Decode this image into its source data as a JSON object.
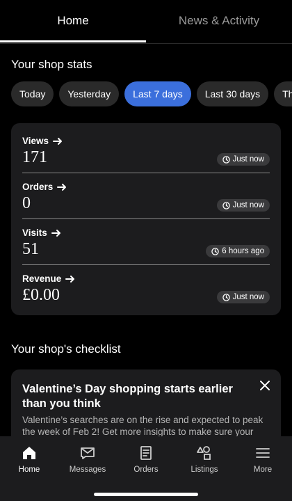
{
  "tabs": [
    {
      "label": "Home",
      "active": true
    },
    {
      "label": "News & Activity",
      "active": false
    }
  ],
  "shop_stats": {
    "title": "Your shop stats",
    "filters": [
      {
        "label": "Today",
        "active": false
      },
      {
        "label": "Yesterday",
        "active": false
      },
      {
        "label": "Last 7 days",
        "active": true
      },
      {
        "label": "Last 30 days",
        "active": false
      },
      {
        "label": "This",
        "active": false
      }
    ],
    "stats": [
      {
        "label": "Views",
        "value": "171",
        "updated": "Just now"
      },
      {
        "label": "Orders",
        "value": "0",
        "updated": "Just now"
      },
      {
        "label": "Visits",
        "value": "51",
        "updated": "6 hours ago"
      },
      {
        "label": "Revenue",
        "value": "£0.00",
        "updated": "Just now"
      }
    ]
  },
  "checklist": {
    "title": "Your shop's checklist",
    "card": {
      "title": "Valentine’s Day shopping starts earlier than you think",
      "body": "Valentine’s searches are on the rise and expected to peak the week of Feb 2! Get more insights to make sure your"
    }
  },
  "bottom_nav": [
    {
      "label": "Home",
      "icon": "home-icon",
      "active": true
    },
    {
      "label": "Messages",
      "icon": "messages-icon",
      "active": false
    },
    {
      "label": "Orders",
      "icon": "orders-icon",
      "active": false
    },
    {
      "label": "Listings",
      "icon": "listings-icon",
      "active": false
    },
    {
      "label": "More",
      "icon": "menu-icon",
      "active": false
    }
  ],
  "colors": {
    "accent": "#3b6fdc",
    "card": "#1c1c1e",
    "background": "#000000"
  }
}
